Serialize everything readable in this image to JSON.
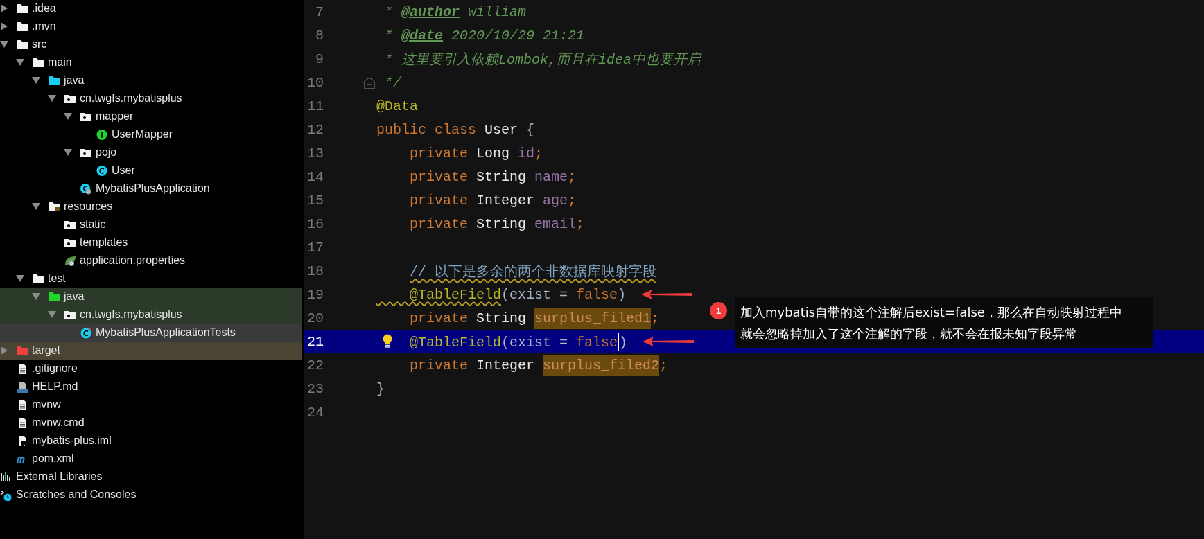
{
  "project_tree": [
    {
      "label": ".idea",
      "kind": "folder",
      "expanded": false,
      "selected": false
    },
    {
      "label": ".mvn",
      "kind": "folder",
      "expanded": false,
      "selected": false
    },
    {
      "label": "src",
      "kind": "folder",
      "expanded": true,
      "selected": false,
      "children": [
        {
          "label": "main",
          "kind": "folder",
          "expanded": true,
          "selected": false,
          "children": [
            {
              "label": "java",
              "kind": "source-folder",
              "expanded": true,
              "selected": false,
              "children": [
                {
                  "label": "cn.twgfs.mybatisplus",
                  "kind": "package",
                  "expanded": true,
                  "selected": false,
                  "children": [
                    {
                      "label": "mapper",
                      "kind": "package",
                      "expanded": true,
                      "selected": false,
                      "children": [
                        {
                          "label": "UserMapper",
                          "kind": "interface",
                          "selected": false
                        }
                      ]
                    },
                    {
                      "label": "pojo",
                      "kind": "package",
                      "expanded": true,
                      "selected": false,
                      "children": [
                        {
                          "label": "User",
                          "kind": "class",
                          "selected": false
                        }
                      ]
                    },
                    {
                      "label": "MybatisPlusApplication",
                      "kind": "spring-class",
                      "selected": false
                    }
                  ]
                }
              ]
            },
            {
              "label": "resources",
              "kind": "resource-folder",
              "expanded": true,
              "selected": false,
              "children": [
                {
                  "label": "static",
                  "kind": "package",
                  "selected": false
                },
                {
                  "label": "templates",
                  "kind": "package",
                  "selected": false
                },
                {
                  "label": "application.properties",
                  "kind": "spring-config",
                  "selected": false
                }
              ]
            }
          ]
        },
        {
          "label": "test",
          "kind": "folder",
          "expanded": true,
          "selected": false,
          "children": [
            {
              "label": "java",
              "kind": "test-folder",
              "expanded": true,
              "selected": false,
              "color": "#2c3a29",
              "children": [
                {
                  "label": "cn.twgfs.mybatisplus",
                  "kind": "package",
                  "expanded": true,
                  "selected": false,
                  "color": "#2c3a29",
                  "children": [
                    {
                      "label": "MybatisPlusApplicationTests",
                      "kind": "test-class",
                      "selected": true
                    }
                  ]
                }
              ]
            }
          ]
        }
      ]
    },
    {
      "label": "target",
      "kind": "excluded-folder",
      "expanded": false,
      "selected": false,
      "color": "#4a4434"
    },
    {
      "label": ".gitignore",
      "kind": "text-file",
      "selected": false
    },
    {
      "label": "HELP.md",
      "kind": "markdown",
      "selected": false
    },
    {
      "label": "mvnw",
      "kind": "text-file",
      "selected": false
    },
    {
      "label": "mvnw.cmd",
      "kind": "text-file",
      "selected": false
    },
    {
      "label": "mybatis-plus.iml",
      "kind": "module-file",
      "selected": false
    },
    {
      "label": "pom.xml",
      "kind": "maven",
      "selected": false
    },
    {
      "label": "External Libraries",
      "kind": "libraries",
      "selected": false
    },
    {
      "label": "Scratches and Consoles",
      "kind": "scratches",
      "selected": false
    }
  ],
  "editor": {
    "lines": [
      {
        "number": "7",
        "current": false,
        "arrow": false,
        "tokens": [
          {
            "text": " * ",
            "kind": "doc"
          },
          {
            "text": "@author",
            "kind": "doc-tag"
          },
          {
            "text": " william",
            "kind": "doc"
          }
        ]
      },
      {
        "number": "8",
        "current": false,
        "arrow": false,
        "tokens": [
          {
            "text": " * ",
            "kind": "doc"
          },
          {
            "text": "@date",
            "kind": "doc-tag"
          },
          {
            "text": " 2020/10/29 21:21",
            "kind": "doc"
          }
        ]
      },
      {
        "number": "9",
        "current": false,
        "arrow": false,
        "tokens": [
          {
            "text": " * 这里要引入依赖Lombok,而且在idea中也要开启",
            "kind": "doc"
          }
        ]
      },
      {
        "number": "10",
        "current": false,
        "arrow": false,
        "gutter": {
          "kind": "fold"
        },
        "tokens": [
          {
            "text": " */",
            "kind": "doc"
          }
        ]
      },
      {
        "number": "11",
        "current": false,
        "arrow": false,
        "tokens": [
          {
            "text": "@Data",
            "kind": "annotation"
          }
        ]
      },
      {
        "number": "12",
        "current": false,
        "arrow": false,
        "tokens": [
          {
            "text": "public class",
            "kind": "keyword"
          },
          {
            "text": " User ",
            "kind": "type"
          },
          {
            "text": "{",
            "kind": "plain"
          }
        ]
      },
      {
        "number": "13",
        "current": false,
        "arrow": false,
        "tokens": [
          {
            "text": "    private",
            "kind": "keyword"
          },
          {
            "text": " Long ",
            "kind": "type"
          },
          {
            "text": "id",
            "kind": "field"
          },
          {
            "text": ";",
            "kind": "keyword"
          }
        ]
      },
      {
        "number": "14",
        "current": false,
        "arrow": false,
        "tokens": [
          {
            "text": "    private",
            "kind": "keyword"
          },
          {
            "text": " String ",
            "kind": "type"
          },
          {
            "text": "name",
            "kind": "field"
          },
          {
            "text": ";",
            "kind": "keyword"
          }
        ]
      },
      {
        "number": "15",
        "current": false,
        "arrow": false,
        "tokens": [
          {
            "text": "    private",
            "kind": "keyword"
          },
          {
            "text": " Integer ",
            "kind": "type"
          },
          {
            "text": "age",
            "kind": "field"
          },
          {
            "text": ";",
            "kind": "keyword"
          }
        ]
      },
      {
        "number": "16",
        "current": false,
        "arrow": false,
        "tokens": [
          {
            "text": "    private",
            "kind": "keyword"
          },
          {
            "text": " String ",
            "kind": "type"
          },
          {
            "text": "email",
            "kind": "field"
          },
          {
            "text": ";",
            "kind": "keyword"
          }
        ]
      },
      {
        "number": "17",
        "current": false,
        "arrow": false
      },
      {
        "number": "18",
        "current": false,
        "arrow": false,
        "tokens": [
          {
            "text": "    // 以下是多余的两个非数据库映射字段",
            "kind": "line-comment-warn"
          }
        ]
      },
      {
        "number": "19",
        "current": false,
        "arrow": true,
        "tokens": [
          {
            "text": "    @TableField",
            "kind": "annotation-warn"
          },
          {
            "text": "(exist = ",
            "kind": "plain"
          },
          {
            "text": "false",
            "kind": "keyword"
          },
          {
            "text": ")",
            "kind": "plain"
          }
        ]
      },
      {
        "number": "20",
        "current": false,
        "arrow": false,
        "tokens": [
          {
            "text": "    private",
            "kind": "keyword"
          },
          {
            "text": " String ",
            "kind": "type"
          },
          {
            "text": "surplus_filed1",
            "kind": "hit"
          },
          {
            "text": ";",
            "kind": "keyword"
          }
        ]
      },
      {
        "number": "21",
        "current": true,
        "arrow": true,
        "gutter": {
          "kind": "bulb"
        },
        "tokens": [
          {
            "text": "    @TableField",
            "kind": "annotation"
          },
          {
            "text": "(exist = ",
            "kind": "plain"
          },
          {
            "text": "false",
            "kind": "keyword"
          },
          {
            "kind": "caret"
          },
          {
            "text": ")",
            "kind": "plain"
          }
        ]
      },
      {
        "number": "22",
        "current": false,
        "arrow": false,
        "tokens": [
          {
            "text": "    private",
            "kind": "keyword"
          },
          {
            "text": " Integer ",
            "kind": "type"
          },
          {
            "text": "surplus_filed2",
            "kind": "hit"
          },
          {
            "text": ";",
            "kind": "keyword"
          }
        ]
      },
      {
        "number": "23",
        "current": false,
        "arrow": false,
        "tokens": [
          {
            "text": "}",
            "kind": "plain"
          }
        ]
      },
      {
        "number": "24",
        "current": false,
        "arrow": false
      }
    ]
  },
  "callout": {
    "badge": "1",
    "lines": [
      "加入mybatis自带的这个注解后exist=false，那么在自动映射过程中",
      "就会忽略掉加入了这个注解的字段，就不会在报未知字段异常"
    ]
  }
}
